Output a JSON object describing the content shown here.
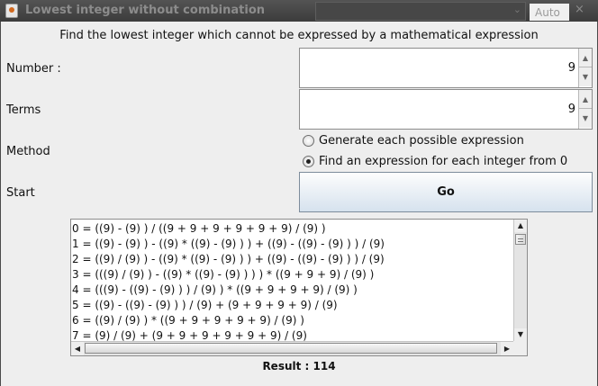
{
  "window": {
    "title": "Lowest integer without combination",
    "background_tab": "Auto",
    "close_glyph": "×"
  },
  "heading": "Find the lowest integer which cannot be expressed by a mathematical expression",
  "fields": {
    "number_label": "Number :",
    "number_value": "9",
    "terms_label": "Terms",
    "terms_value": "9",
    "method_label": "Method",
    "start_label": "Start"
  },
  "method_options": [
    {
      "label": "Generate each possible expression",
      "selected": false
    },
    {
      "label": "Find an expression for each integer from 0",
      "selected": true
    }
  ],
  "go_button": "Go",
  "results": [
    "0 = ((9) - (9) ) / ((9 + 9  + 9  + 9  + 9  + 9) / (9) )",
    "1 = ((9) - (9) ) - ((9) * ((9) - (9) ) )  + ((9) - ((9) - (9) ) ) / (9)",
    "2 = ((9) / (9) ) - ((9) * ((9) - (9) ) )  + ((9) - ((9) - (9) ) ) / (9)",
    "3 = (((9) / (9) ) - ((9) * ((9) - (9) ) ) ) * ((9 + 9  + 9) / (9) )",
    "4 = (((9) - ((9) - (9) ) ) / (9) ) * ((9 + 9  + 9  + 9) / (9) )",
    "5 = ((9) - ((9) - (9) ) ) / (9)  + (9 + 9  + 9  + 9) / (9)",
    "6 = ((9) / (9) ) * ((9 + 9  + 9  + 9  + 9) / (9) )",
    "7 = (9) / (9)  + (9 + 9  + 9  + 9  + 9  + 9) / (9)"
  ],
  "result_text": "Result : 114",
  "icons": {
    "spin_up": "▲",
    "spin_down": "▼",
    "scroll_left": "◀",
    "scroll_right": "▶",
    "combo_chevron": "⌄"
  }
}
